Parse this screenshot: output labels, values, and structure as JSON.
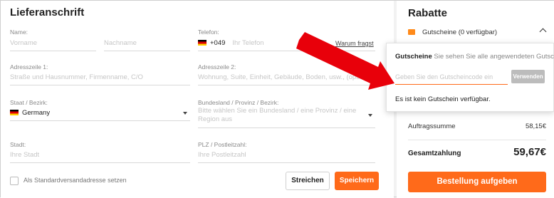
{
  "address": {
    "title": "Lieferanschrift",
    "name_label": "Name:",
    "firstname_placeholder": "Vorname",
    "lastname_placeholder": "Nachname",
    "phone_label": "Telefon:",
    "phone_code": "+049",
    "phone_placeholder": "Ihr Telefon",
    "phone_help": "Warum fragst",
    "addr1_label": "Adresszeile 1:",
    "addr1_placeholder": "Straße und Hausnummer, Firmenname, C/O",
    "addr2_label": "Adresszeile 2:",
    "addr2_placeholder": "Wohnung, Suite, Einheit, Gebäude, Boden, usw., (optional)",
    "state_label": "Staat / Bezirk:",
    "state_value": "Germany",
    "province_label": "Bundesland / Provinz / Bezirk:",
    "province_placeholder_line1": "Bitte wählen Sie ein Bundesland / eine Provinz / eine",
    "province_placeholder_line2": "Region aus",
    "city_label": "Stadt:",
    "city_placeholder": "Ihre Stadt",
    "zip_label": "PLZ / Postleitzahl:",
    "zip_placeholder": "Ihre Postleitzahl",
    "default_checkbox_label": "Als Standardversandadresse setzen",
    "cancel_label": "Streichen",
    "save_label": "Speichern"
  },
  "discounts": {
    "title": "Rabatte",
    "coupons_label": "Gutscheine (0 verfügbar)",
    "order_sum_label": "Auftragssumme",
    "order_sum_value": "58,15€",
    "total_label": "Gesamtzahlung",
    "total_value": "59,67€",
    "order_button": "Bestellung aufgeben"
  },
  "coupon_popup": {
    "title": "Gutscheine",
    "subtitle": "Sie sehen Sie alle angewendeten Gutscheine",
    "input_placeholder": "Geben Sie den Gutscheincode ein",
    "apply_button": "Verwenden",
    "empty_text": "Es ist kein Gutschein verfügbar."
  },
  "colors": {
    "accent": "#ff6a1a",
    "arrow": "#e8000a"
  }
}
